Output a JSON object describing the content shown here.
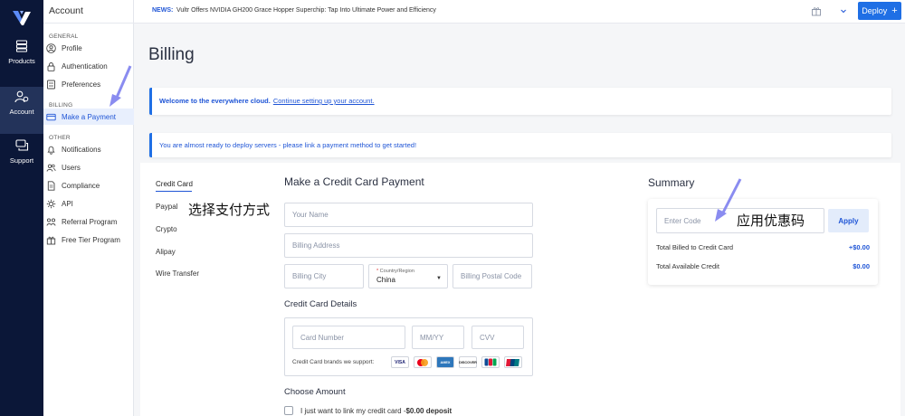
{
  "rail": {
    "items": [
      {
        "label": "Products",
        "icon": "server-icon"
      },
      {
        "label": "Account",
        "icon": "account-icon"
      },
      {
        "label": "Support",
        "icon": "support-icon"
      }
    ]
  },
  "account_panel": {
    "title": "Account",
    "groups": [
      {
        "label": "GENERAL",
        "items": [
          {
            "label": "Profile",
            "icon": "user-icon"
          },
          {
            "label": "Authentication",
            "icon": "lock-icon"
          },
          {
            "label": "Preferences",
            "icon": "sliders-icon"
          }
        ]
      },
      {
        "label": "BILLING",
        "items": [
          {
            "label": "Make a Payment",
            "icon": "card-icon",
            "active": true
          }
        ]
      },
      {
        "label": "OTHER",
        "items": [
          {
            "label": "Notifications",
            "icon": "bell-icon"
          },
          {
            "label": "Users",
            "icon": "users-icon"
          },
          {
            "label": "Compliance",
            "icon": "document-icon"
          },
          {
            "label": "API",
            "icon": "api-icon"
          },
          {
            "label": "Referral Program",
            "icon": "referral-icon"
          },
          {
            "label": "Free Tier Program",
            "icon": "gift-icon"
          }
        ]
      }
    ]
  },
  "topbar": {
    "news_tag": "NEWS:",
    "news_text": "Vultr Offers NVIDIA GH200 Grace Hopper Superchip: Tap Into Ultimate Power and Efficiency",
    "deploy_label": "Deploy",
    "deploy_icon": "+"
  },
  "page": {
    "title": "Billing",
    "banner_welcome_strong": "Welcome to the everywhere cloud.",
    "banner_welcome_link": "Continue setting up your account.",
    "banner_notice": "You are almost ready to deploy servers - please link a payment method to get started!"
  },
  "payment_methods": [
    "Credit Card",
    "Paypal",
    "Crypto",
    "Alipay",
    "Wire Transfer"
  ],
  "form": {
    "title": "Make a Credit Card Payment",
    "name_placeholder": "Your Name",
    "address_placeholder": "Billing Address",
    "city_placeholder": "Billing City",
    "country_label": "Country/Region",
    "country_required": "*",
    "country_value": "China",
    "postal_placeholder": "Billing Postal Code",
    "card_details_title": "Credit Card Details",
    "card_number_placeholder": "Card Number",
    "expiry_placeholder": "MM/YY",
    "cvv_placeholder": "CVV",
    "brands_label": "Credit Card brands we support:",
    "brands": [
      "VISA",
      "MC",
      "AMEX",
      "DISCOVER",
      "JCB",
      "UnionPay"
    ],
    "amount_title": "Choose Amount",
    "link_only_label": "I just want to link my credit card -",
    "link_only_amount": "$0.00 deposit"
  },
  "summary": {
    "title": "Summary",
    "code_placeholder": "Enter Code",
    "apply_label": "Apply",
    "rows": [
      {
        "label": "Total Billed to Credit Card",
        "value": "+$0.00"
      },
      {
        "label": "Total Available Credit",
        "value": "$0.00"
      }
    ]
  },
  "annotations": {
    "choose_payment": "选择支付方式",
    "apply_coupon": "应用优惠码"
  },
  "colors": {
    "accent": "#1f6fe5",
    "rail": "#0b1738",
    "annotation_arrow": "#8a8cf0"
  }
}
